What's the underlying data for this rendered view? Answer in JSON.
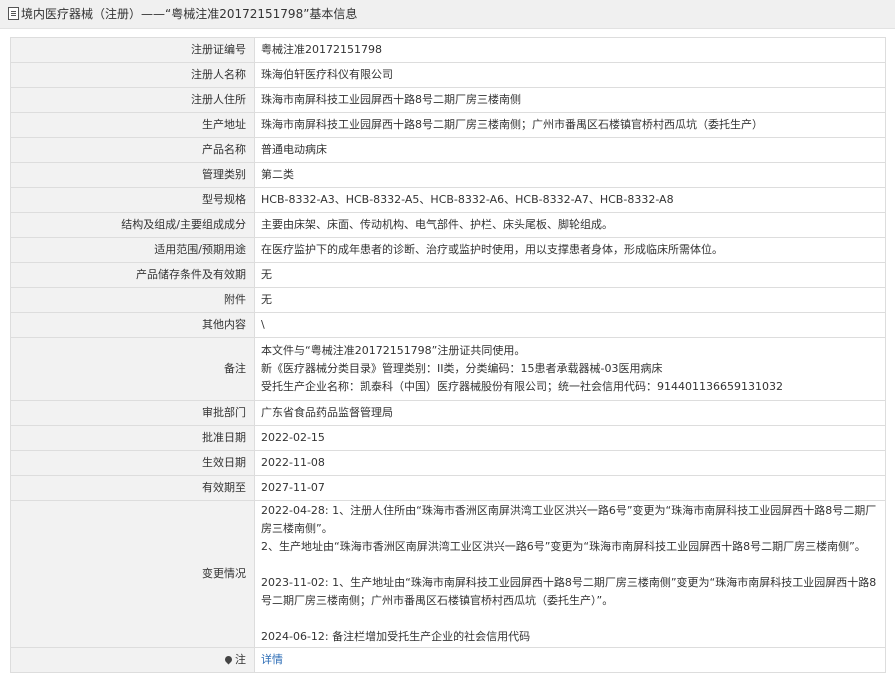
{
  "header": {
    "icon": "document-icon",
    "text": "境内医疗器械（注册）——“粤械注准20172151798”基本信息"
  },
  "rows": [
    {
      "label": "注册证编号",
      "value": "粤械注准20172151798"
    },
    {
      "label": "注册人名称",
      "value": "珠海伯轩医疗科仪有限公司"
    },
    {
      "label": "注册人住所",
      "value": "珠海市南屏科技工业园屏西十路8号二期厂房三楼南侧"
    },
    {
      "label": "生产地址",
      "value": "珠海市南屏科技工业园屏西十路8号二期厂房三楼南侧；广州市番禺区石楼镇官桥村西瓜坑（委托生产）"
    },
    {
      "label": "产品名称",
      "value": "普通电动病床"
    },
    {
      "label": "管理类别",
      "value": "第二类"
    },
    {
      "label": "型号规格",
      "value": "HCB-8332-A3、HCB-8332-A5、HCB-8332-A6、HCB-8332-A7、HCB-8332-A8"
    },
    {
      "label": "结构及组成/主要组成成分",
      "value": "主要由床架、床面、传动机构、电气部件、护栏、床头尾板、脚轮组成。"
    },
    {
      "label": "适用范围/预期用途",
      "value": "在医疗监护下的成年患者的诊断、治疗或监护时使用，用以支撑患者身体，形成临床所需体位。"
    },
    {
      "label": "产品储存条件及有效期",
      "value": "无"
    },
    {
      "label": "附件",
      "value": "无"
    },
    {
      "label": "其他内容",
      "value": "\\"
    },
    {
      "label": "备注",
      "lines": [
        "本文件与“粤械注准20172151798”注册证共同使用。",
        "新《医疗器械分类目录》管理类别：II类，分类编码：15患者承载器械-03医用病床",
        "受托生产企业名称：凯泰科（中国）医疗器械股份有限公司；统一社会信用代码：914401136659131032"
      ]
    },
    {
      "label": "审批部门",
      "value": "广东省食品药品监督管理局"
    },
    {
      "label": "批准日期",
      "value": "2022-02-15"
    },
    {
      "label": "生效日期",
      "value": "2022-11-08"
    },
    {
      "label": "有效期至",
      "value": "2027-11-07"
    },
    {
      "label": "变更情况",
      "lines": [
        "2022-04-28: 1、注册人住所由“珠海市香洲区南屏洪湾工业区洪兴一路6号”变更为“珠海市南屏科技工业园屏西十路8号二期厂房三楼南侧”。",
        "2、生产地址由“珠海市香洲区南屏洪湾工业区洪兴一路6号”变更为“珠海市南屏科技工业园屏西十路8号二期厂房三楼南侧”。",
        "",
        "2023-11-02: 1、生产地址由“珠海市南屏科技工业园屏西十路8号二期厂房三楼南侧”变更为“珠海市南屏科技工业园屏西十路8号二期厂房三楼南侧；广州市番禺区石楼镇官桥村西瓜坑（委托生产）”。",
        "",
        "2024-06-12: 备注栏增加受托生产企业的社会信用代码"
      ]
    }
  ],
  "footer_row": {
    "label": "注",
    "icon": "pin-icon",
    "link": "详情"
  }
}
